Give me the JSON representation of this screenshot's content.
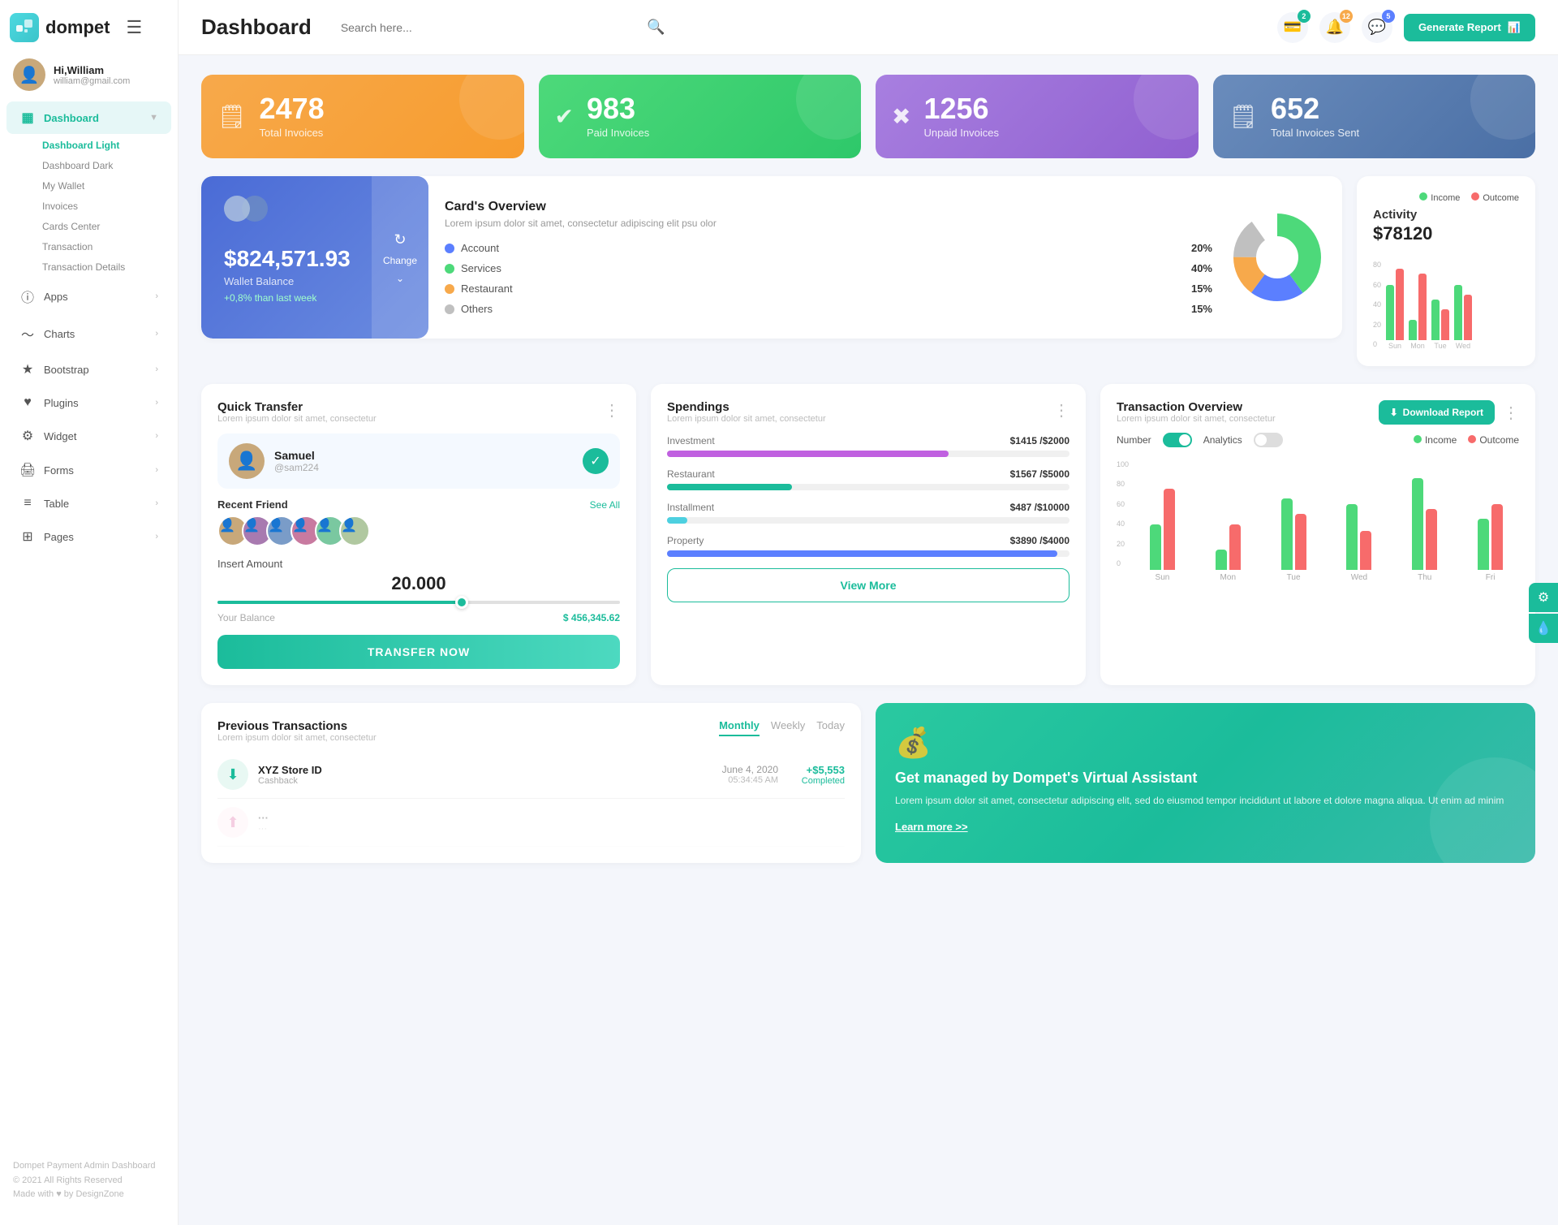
{
  "app": {
    "name": "dompet",
    "title": "Dashboard"
  },
  "sidebar": {
    "user": {
      "name": "Hi,William",
      "email": "william@gmail.com"
    },
    "nav": [
      {
        "id": "dashboard",
        "label": "Dashboard",
        "icon": "▦",
        "active": true,
        "hasChevron": true
      },
      {
        "id": "apps",
        "label": "Apps",
        "icon": "ℹ",
        "hasChevron": true
      },
      {
        "id": "charts",
        "label": "Charts",
        "icon": "〜",
        "hasChevron": true
      },
      {
        "id": "bootstrap",
        "label": "Bootstrap",
        "icon": "★",
        "hasChevron": true
      },
      {
        "id": "plugins",
        "label": "Plugins",
        "icon": "♥",
        "hasChevron": true
      },
      {
        "id": "widget",
        "label": "Widget",
        "icon": "⚙",
        "hasChevron": true
      },
      {
        "id": "forms",
        "label": "Forms",
        "icon": "🖨",
        "hasChevron": true
      },
      {
        "id": "table",
        "label": "Table",
        "icon": "≡",
        "hasChevron": true
      },
      {
        "id": "pages",
        "label": "Pages",
        "icon": "⊞",
        "hasChevron": true
      }
    ],
    "submenu": [
      "Dashboard Light",
      "Dashboard Dark",
      "My Wallet",
      "Invoices",
      "Cards Center",
      "Transaction",
      "Transaction Details"
    ],
    "footer": {
      "brand": "Dompet Payment Admin Dashboard",
      "copy": "© 2021 All Rights Reserved",
      "credit": "Made with ♥ by DesignZone"
    }
  },
  "header": {
    "search_placeholder": "Search here...",
    "generate_btn": "Generate Report",
    "badges": {
      "wallet": "2",
      "bell": "12",
      "chat": "5"
    }
  },
  "stats": [
    {
      "id": "total",
      "num": "2478",
      "label": "Total Invoices",
      "color": "orange",
      "icon": "🗒"
    },
    {
      "id": "paid",
      "num": "983",
      "label": "Paid Invoices",
      "color": "green",
      "icon": "✔"
    },
    {
      "id": "unpaid",
      "num": "1256",
      "label": "Unpaid Invoices",
      "color": "purple",
      "icon": "✖"
    },
    {
      "id": "sent",
      "num": "652",
      "label": "Total Invoices Sent",
      "color": "blue-gray",
      "icon": "🗒"
    }
  ],
  "wallet": {
    "amount": "$824,571.93",
    "label": "Wallet Balance",
    "change": "+0,8% than last week",
    "change_btn_label": "Change"
  },
  "cards_overview": {
    "title": "Card's Overview",
    "sub": "Lorem ipsum dolor sit amet, consectetur adipiscing elit psu olor",
    "legend": [
      {
        "label": "Account",
        "color": "#5b7fff",
        "pct": "20%"
      },
      {
        "label": "Services",
        "color": "#4dd97a",
        "pct": "40%"
      },
      {
        "label": "Restaurant",
        "color": "#f7a94b",
        "pct": "15%"
      },
      {
        "label": "Others",
        "color": "#c0c0c0",
        "pct": "15%"
      }
    ]
  },
  "activity": {
    "title": "Activity",
    "amount": "$78120",
    "legend": [
      {
        "label": "Income",
        "color": "#4dd97a"
      },
      {
        "label": "Outcome",
        "color": "#f76b6b"
      }
    ],
    "bars": [
      {
        "day": "Sun",
        "income": 55,
        "outcome": 70
      },
      {
        "day": "Mon",
        "income": 20,
        "outcome": 65
      },
      {
        "day": "Tue",
        "income": 40,
        "outcome": 30
      },
      {
        "day": "Wed",
        "income": 55,
        "outcome": 45
      }
    ]
  },
  "quick_transfer": {
    "title": "Quick Transfer",
    "sub": "Lorem ipsum dolor sit amet, consectetur",
    "user": {
      "name": "Samuel",
      "handle": "@sam224"
    },
    "friends_label": "Recent Friend",
    "see_all": "See All",
    "amount_label": "Insert Amount",
    "amount": "20.000",
    "balance_label": "Your Balance",
    "balance": "$ 456,345.62",
    "btn": "TRANSFER NOW"
  },
  "spendings": {
    "title": "Spendings",
    "sub": "Lorem ipsum dolor sit amet, consectetur",
    "items": [
      {
        "label": "Investment",
        "current": 1415,
        "max": 2000,
        "color": "#c060e0",
        "pct": 70
      },
      {
        "label": "Restaurant",
        "current": 1567,
        "max": 5000,
        "color": "#1bbc9b",
        "pct": 31
      },
      {
        "label": "Installment",
        "current": 487,
        "max": 10000,
        "color": "#4dd0e0",
        "pct": 5
      },
      {
        "label": "Property",
        "current": 3890,
        "max": 4000,
        "color": "#5b7fff",
        "pct": 97
      }
    ],
    "view_more": "View More"
  },
  "tx_overview": {
    "title": "Transaction Overview",
    "sub": "Lorem ipsum dolor sit amet, consectetur",
    "download_btn": "Download Report",
    "toggles": [
      {
        "label": "Number",
        "on": true
      },
      {
        "label": "Analytics",
        "on": false
      }
    ],
    "legend": [
      {
        "label": "Income",
        "color": "#4dd97a"
      },
      {
        "label": "Outcome",
        "color": "#f76b6b"
      }
    ],
    "bars": [
      {
        "day": "Sun",
        "income": 45,
        "outcome": 80
      },
      {
        "day": "Mon",
        "income": 20,
        "outcome": 45
      },
      {
        "day": "Tue",
        "income": 70,
        "outcome": 55
      },
      {
        "day": "Wed",
        "income": 65,
        "outcome": 38
      },
      {
        "day": "Thu",
        "income": 90,
        "outcome": 60
      },
      {
        "day": "Fri",
        "income": 50,
        "outcome": 65
      }
    ],
    "y_labels": [
      "100",
      "80",
      "60",
      "40",
      "20",
      "0"
    ]
  },
  "prev_transactions": {
    "title": "Previous Transactions",
    "sub": "Lorem ipsum dolor sit amet, consectetur",
    "tabs": [
      "Monthly",
      "Weekly",
      "Today"
    ],
    "active_tab": "Monthly",
    "items": [
      {
        "store": "XYZ Store ID",
        "type": "Cashback",
        "date": "June 4, 2020",
        "time": "05:34:45 AM",
        "amount": "+$5,553",
        "status": "Completed",
        "icon": "⬇",
        "icon_color": "green"
      }
    ]
  },
  "virtual_assistant": {
    "title": "Get managed by Dompet's Virtual Assistant",
    "sub": "Lorem ipsum dolor sit amet, consectetur adipiscing elit, sed do eiusmod tempor incididunt ut labore et dolore magna aliqua. Ut enim ad minim",
    "link": "Learn more >>"
  }
}
